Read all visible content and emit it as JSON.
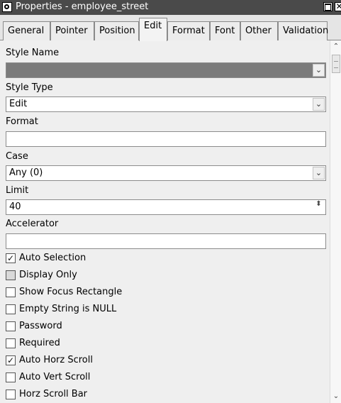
{
  "window": {
    "title": "Properties - employee_street",
    "close_glyph": "✕"
  },
  "tabs": [
    "General",
    "Pointer",
    "Position",
    "Edit",
    "Format",
    "Font",
    "Other",
    "Validation"
  ],
  "active_tab": "Edit",
  "form": {
    "style_name": {
      "label": "Style Name",
      "value": ""
    },
    "style_type": {
      "label": "Style Type",
      "value": "Edit"
    },
    "format": {
      "label": "Format",
      "value": ""
    },
    "case": {
      "label": "Case",
      "value": "Any (0)"
    },
    "limit": {
      "label": "Limit",
      "value": "40"
    },
    "accelerator": {
      "label": "Accelerator",
      "value": ""
    }
  },
  "checkboxes": [
    {
      "label": "Auto Selection",
      "checked": true
    },
    {
      "label": "Display Only",
      "checked": false
    },
    {
      "label": "Show Focus Rectangle",
      "checked": false
    },
    {
      "label": "Empty String is NULL",
      "checked": false
    },
    {
      "label": "Password",
      "checked": false
    },
    {
      "label": "Required",
      "checked": false
    },
    {
      "label": "Auto Horz Scroll",
      "checked": true
    },
    {
      "label": "Auto Vert Scroll",
      "checked": false
    },
    {
      "label": "Horz Scroll Bar",
      "checked": false
    }
  ],
  "glyphs": {
    "dropdown": "⌄",
    "check": "✓",
    "spin": "⬍",
    "scroll_up": "⌃",
    "scroll_down": "⌄"
  }
}
